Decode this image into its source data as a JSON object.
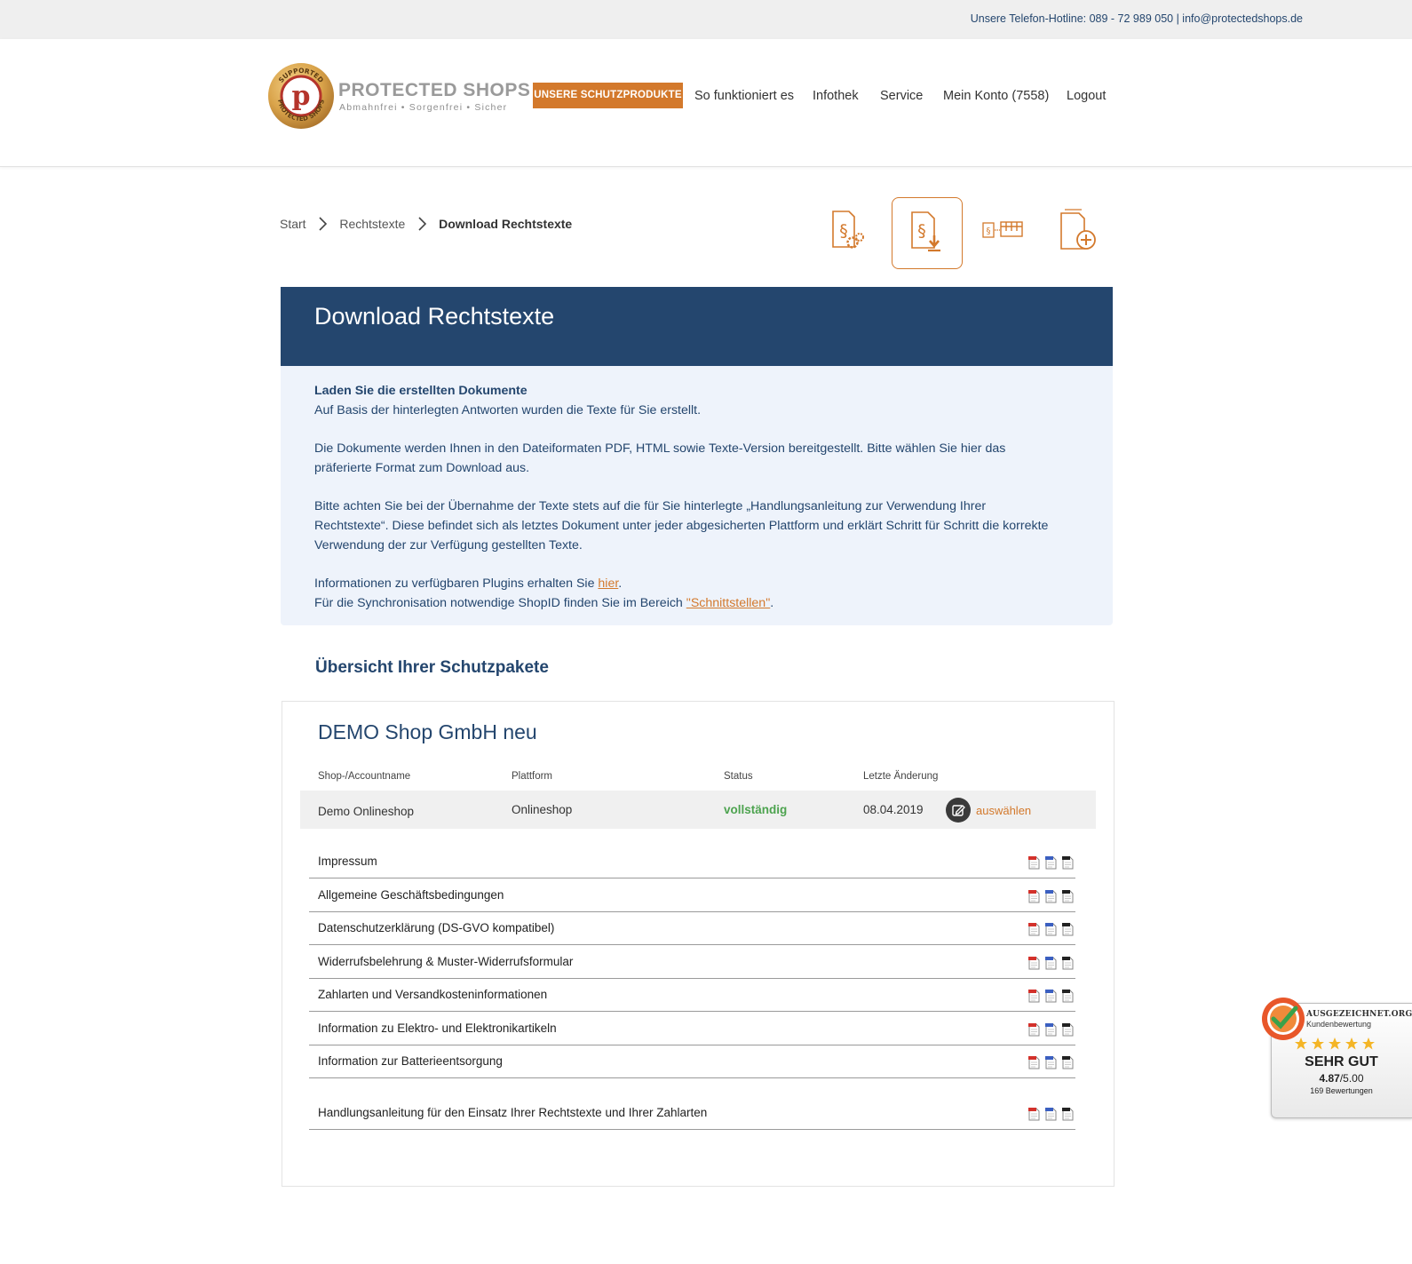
{
  "topbar": {
    "hotline": "Unsere Telefon-Hotline: 089 - 72 989 050 | info@protectedshops.de"
  },
  "header": {
    "logo": {
      "seal_text_top": "SUPPORTED",
      "seal_text_bottom": "PROTECTED SHOPS",
      "seal_letter": "p",
      "brand": "PROTECTED SHOPS",
      "slogan": "Abmahnfrei • Sorgenfrei • Sicher"
    },
    "cta_label": "UNSERE SCHUTZPRODUKTE",
    "nav": [
      {
        "label": "So funktioniert es"
      },
      {
        "label": "Infothek"
      },
      {
        "label": "Service"
      },
      {
        "label": "Mein Konto (7558)"
      },
      {
        "label": "Logout"
      }
    ]
  },
  "breadcrumb": {
    "items": [
      "Start",
      "Rechtstexte"
    ],
    "current": "Download Rechtstexte"
  },
  "toolbar": {
    "icons": [
      "legal-settings-icon",
      "legal-download-icon",
      "legal-shop-icon",
      "add-document-icon"
    ],
    "active_index": 1
  },
  "hero": {
    "title": "Download Rechtstexte"
  },
  "intro": {
    "heading": "Laden Sie die erstellten Dokumente",
    "line1": "Auf Basis der hinterlegten Antworten wurden die Texte für Sie erstellt.",
    "para2": "Die Dokumente werden Ihnen in den Dateiformaten PDF, HTML sowie Texte-Version bereitgestellt. Bitte wählen Sie hier das präferierte Format zum Download aus.",
    "para3": "Bitte achten Sie bei der Übernahme der Texte stets auf die für Sie hinterlegte „Handlungsanleitung zur Verwendung Ihrer Rechtstexte“. Diese befindet sich als letztes Dokument unter jeder abgesicherten Plattform und erklärt Schritt für Schritt die korrekte Verwendung der zur Verfügung gestellten Texte.",
    "plugins_prefix": "Informationen zu verfügbaren Plugins erhalten Sie ",
    "plugins_link": "hier",
    "plugins_suffix": ".",
    "shopid_prefix": "Für die Synchronisation notwendige ShopID finden Sie im Bereich ",
    "shopid_link": "\"Schnittstellen\"",
    "shopid_suffix": "."
  },
  "overview": {
    "title": "Übersicht Ihrer Schutzpakete"
  },
  "package": {
    "name": "DEMO Shop GmbH neu",
    "columns": [
      "Shop-/Accountname",
      "Plattform",
      "Status",
      "Letzte Änderung"
    ],
    "row": {
      "account": "Demo Onlineshop",
      "platform": "Onlineshop",
      "status": "vollständig",
      "last_change": "08.04.2019",
      "action": "auswählen"
    },
    "documents": [
      {
        "label": "Impressum"
      },
      {
        "label": "Allgemeine Geschäftsbedingungen"
      },
      {
        "label": "Datenschutzerklärung (DS-GVO kompatibel)"
      },
      {
        "label": "Widerrufsbelehrung & Muster-Widerrufsformular"
      },
      {
        "label": "Zahlarten und Versandkosteninformationen"
      },
      {
        "label": "Information zu Elektro- und Elektronikartikeln"
      },
      {
        "label": "Information zur Batterieentsorgung"
      }
    ],
    "guide": {
      "label": "Handlungsanleitung für den Einsatz Ihrer Rechtstexte und Ihrer Zahlarten"
    },
    "download_formats": [
      "pdf-icon",
      "html-icon",
      "txt-icon"
    ]
  },
  "rating_widget": {
    "brand": "AUSGEZEICHNET.ORG",
    "sub": "Kundenbewertung",
    "stars": 5,
    "grade": "SEHR GUT",
    "score": "4.87",
    "max": "/5.00",
    "count": "169 Bewertungen"
  },
  "colors": {
    "brand_blue": "#24466e",
    "accent_orange": "#d3792c",
    "status_green": "#4da34f",
    "intro_bg": "#eef3fb"
  }
}
